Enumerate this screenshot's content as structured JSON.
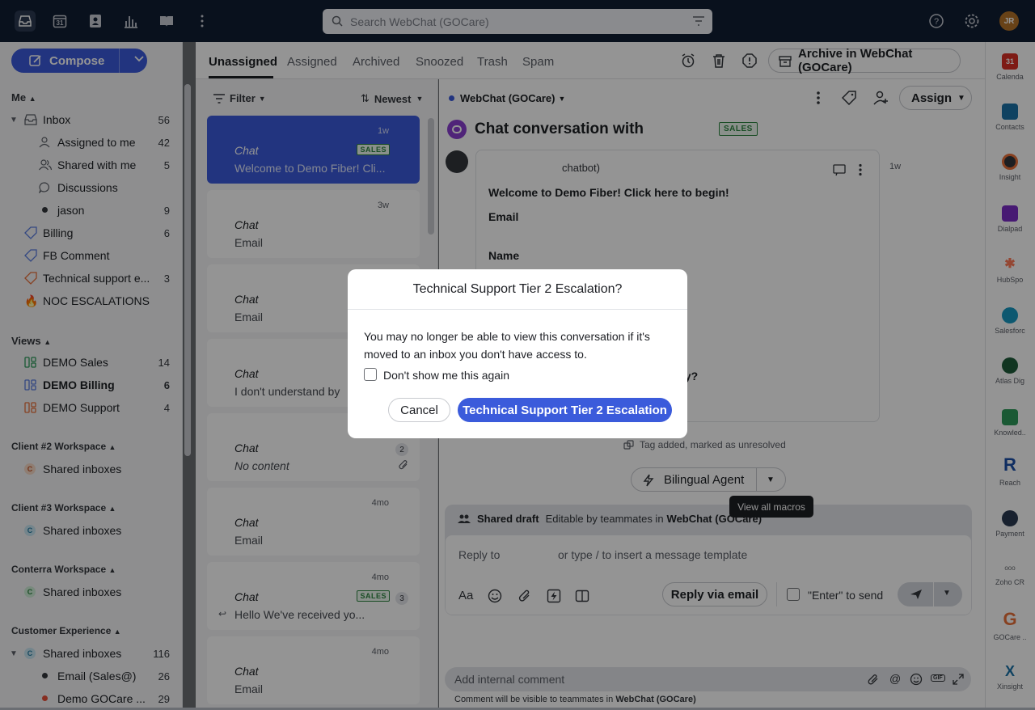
{
  "topbar": {
    "search_placeholder": "Search WebChat (GOCare)",
    "avatar_initials": "JR",
    "calendar_day": "31"
  },
  "compose": {
    "label": "Compose"
  },
  "nav": {
    "me_label": "Me",
    "inbox": {
      "label": "Inbox",
      "count": "56"
    },
    "assigned": {
      "label": "Assigned to me",
      "count": "42"
    },
    "shared": {
      "label": "Shared with me",
      "count": "5"
    },
    "discussions": {
      "label": "Discussions"
    },
    "jason": {
      "label": "jason",
      "count": "9"
    },
    "billing": {
      "label": "Billing",
      "count": "6"
    },
    "fb": {
      "label": "FB Comment"
    },
    "tech": {
      "label": "Technical support e...",
      "count": "3"
    },
    "noc": {
      "label": "NOC ESCALATIONS"
    },
    "views_label": "Views",
    "demo_sales": {
      "label": "DEMO Sales",
      "count": "14"
    },
    "demo_billing": {
      "label": "DEMO Billing",
      "count": "6"
    },
    "demo_support": {
      "label": "DEMO Support",
      "count": "4"
    },
    "client2": "Client #2 Workspace",
    "client3": "Client #3 Workspace",
    "conterra": "Conterra Workspace",
    "cx": "Customer Experience",
    "shared_inboxes": "Shared inboxes",
    "cx_shared": {
      "label": "Shared inboxes",
      "count": "116"
    },
    "email_sales": {
      "label": "Email (Sales@)",
      "count": "26"
    },
    "demo_gocare": {
      "label": "Demo GOCare ...",
      "count": "29"
    }
  },
  "tabs": [
    "Unassigned",
    "Assigned",
    "Archived",
    "Snoozed",
    "Trash",
    "Spam"
  ],
  "archive_label": "Archive in WebChat (GOCare)",
  "list": {
    "filter": "Filter",
    "sort": "Newest",
    "cards": [
      {
        "title": "Chat",
        "sub": "Welcome to Demo Fiber! Cli...",
        "time": "1w",
        "badge": "SALES"
      },
      {
        "title": "Chat",
        "sub": "Email",
        "time": "3w"
      },
      {
        "title": "Chat",
        "sub": "Email"
      },
      {
        "title": "Chat",
        "sub": "I don't understand by"
      },
      {
        "title": "Chat",
        "sub": "No content",
        "count": "2"
      },
      {
        "title": "Chat",
        "sub": "Email",
        "time": "4mo"
      },
      {
        "title": "Chat",
        "sub": "Hello      We've received yo...",
        "time": "4mo",
        "badge": "SALES",
        "count": "3"
      },
      {
        "title": "Chat",
        "sub": "Email",
        "time": "4mo"
      }
    ]
  },
  "convo": {
    "inbox": "WebChat (GOCare)",
    "assign": "Assign",
    "title": "Chat conversation with",
    "badge": "SALES",
    "sender": "chatbot)",
    "time": "1w",
    "welcome": "Welcome to Demo Fiber! Click here to begin!",
    "email": "Email",
    "name": "Name",
    "partial_q": "ay?",
    "tag_event": "Tag added, marked as unresolved",
    "macro": "Bilingual Agent",
    "tooltip": "View all macros",
    "draft_label": "Shared draft",
    "draft_editable": "Editable by teammates in",
    "draft_inbox": "WebChat (GOCare)",
    "reply_to": "Reply to",
    "reply_hint": "or type / to insert a message template",
    "reply_email": "Reply via email",
    "enter_send": "\"Enter\" to send",
    "comment_placeholder": "Add internal comment",
    "comment_note": "Comment will be visible to teammates in",
    "comment_inbox": "WebChat (GOCare)"
  },
  "rail": [
    "Calenda",
    "Contacts",
    "Insight",
    "Dialpad",
    "HubSpo",
    "Salesforc",
    "Atlas Dig",
    "Knowled..",
    "Reach",
    "Payment",
    "Zoho CR",
    "GOCare ..",
    "Xinsight"
  ],
  "modal": {
    "title": "Technical Support Tier 2 Escalation?",
    "message": "You may no longer be able to view this conversation if it's moved to an inbox you don't have access to.",
    "checkbox": "Don't show me this again",
    "cancel": "Cancel",
    "confirm": "Technical Support Tier 2 Escalation"
  },
  "colors": {
    "accent": "#3b5bdb",
    "topbar": "#101e33",
    "sales": "#2e8540"
  }
}
